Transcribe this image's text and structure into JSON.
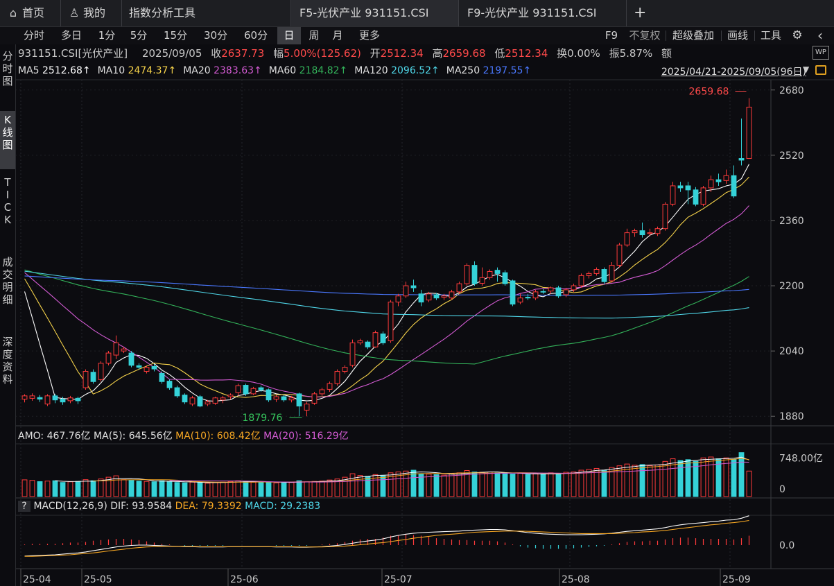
{
  "tabs": [
    {
      "icon": "home-icon",
      "label": "首页"
    },
    {
      "icon": "user-icon",
      "label": "我的"
    },
    {
      "label": "指数分析工具"
    },
    {
      "label": "F5-光伏产业 931151.CSI"
    },
    {
      "label": "F9-光伏产业 931151.CSI"
    },
    {
      "label": "+"
    }
  ],
  "periods": [
    "分时",
    "多日",
    "1分",
    "5分",
    "15分",
    "30分",
    "60分",
    "日",
    "周",
    "月",
    "更多"
  ],
  "active_period": "日",
  "toolbar_right": [
    "F9",
    "不复权",
    "超级叠加",
    "画线",
    "工具"
  ],
  "side_nav": [
    "分时图",
    "K线图",
    "TICK",
    "成交明细",
    "深度资料"
  ],
  "quote": {
    "code": "931151.CSI[光伏产业]",
    "date": "2025/09/05",
    "close_label": "收",
    "close": "2637.73",
    "change_label": "幅",
    "change": "5.00%(125.62)",
    "open_label": "开",
    "open": "2512.34",
    "high_label": "高",
    "high": "2659.68",
    "low_label": "低",
    "low": "2512.34",
    "turnover_label": "换",
    "turnover": "0.00%",
    "amplitude_label": "振",
    "amplitude": "5.87%",
    "amount_label": "额"
  },
  "ma_row": [
    {
      "label": "MA5",
      "value": "2512.68↑",
      "color": "#ffffff"
    },
    {
      "label": "MA10",
      "value": "2474.37↑",
      "color": "#f5d24a"
    },
    {
      "label": "MA20",
      "value": "2383.63↑",
      "color": "#d35bd3"
    },
    {
      "label": "MA60",
      "value": "2184.82↑",
      "color": "#33b35a"
    },
    {
      "label": "MA120",
      "value": "2096.52↑",
      "color": "#4fd6e8"
    },
    {
      "label": "MA250",
      "value": "2197.55↑",
      "color": "#4a78ff"
    }
  ],
  "range_text": "2025/04/21-2025/09/05(96日)",
  "price_axis": [
    "2680",
    "2520",
    "2360",
    "2200",
    "2040",
    "1880"
  ],
  "high_marker": "2659.68",
  "low_marker": "1879.76",
  "amo_header": {
    "amo": "AMO: 467.76亿",
    "ma5": "MA(5): 645.56亿",
    "ma10": "MA(10): 608.42亿",
    "ma20": "MA(20): 516.29亿"
  },
  "vol_axis": [
    "748.00亿",
    "0"
  ],
  "macd_header": {
    "q": "?",
    "name": "MACD(12,26,9)",
    "dif": "DIF: 93.9584",
    "dea": "DEA: 79.3392",
    "macd": "MACD: 29.2383"
  },
  "macd_axis": [
    "0.0"
  ],
  "date_axis": [
    "25-04",
    "25-05",
    "25-06",
    "25-07",
    "25-08",
    "25-09"
  ],
  "colors": {
    "up": "#ff3b3b",
    "down": "#35d2d8",
    "ma5": "#ffffff",
    "ma10": "#f5d24a",
    "ma20": "#d35bd3",
    "ma60": "#33b35a",
    "ma120": "#4fd6e8",
    "ma250": "#4a78ff"
  },
  "chart_data": {
    "type": "candlestick",
    "ylim": [
      1860,
      2700
    ],
    "candles": [
      [
        1922,
        1930,
        1914,
        1934
      ],
      [
        1924,
        1930,
        1918,
        1936
      ],
      [
        1926,
        1922,
        1915,
        1932
      ],
      [
        1910,
        1930,
        1905,
        1934
      ],
      [
        1930,
        1920,
        1912,
        1935
      ],
      [
        1922,
        1915,
        1908,
        1928
      ],
      [
        1918,
        1925,
        1912,
        1930
      ],
      [
        1924,
        1918,
        1910,
        1928
      ],
      [
        1950,
        1990,
        1945,
        1995
      ],
      [
        1988,
        1965,
        1960,
        1995
      ],
      [
        1970,
        2010,
        1965,
        2015
      ],
      [
        2010,
        2035,
        2005,
        2040
      ],
      [
        2030,
        2060,
        2020,
        2078
      ],
      [
        2040,
        2045,
        2035,
        2050
      ],
      [
        2035,
        2005,
        2000,
        2040
      ],
      [
        2004,
        2000,
        1995,
        2010
      ],
      [
        1990,
        2000,
        1985,
        2005
      ],
      [
        2002,
        1996,
        1990,
        2008
      ],
      [
        1985,
        1965,
        1960,
        1990
      ],
      [
        1966,
        1950,
        1945,
        1970
      ],
      [
        1950,
        1930,
        1925,
        1955
      ],
      [
        1932,
        1915,
        1910,
        1936
      ],
      [
        1910,
        1925,
        1905,
        1930
      ],
      [
        1928,
        1905,
        1902,
        1932
      ],
      [
        1910,
        1915,
        1905,
        1920
      ],
      [
        1912,
        1925,
        1908,
        1928
      ],
      [
        1920,
        1925,
        1912,
        1930
      ],
      [
        1928,
        1932,
        1922,
        1936
      ],
      [
        1938,
        1955,
        1930,
        1960
      ],
      [
        1956,
        1935,
        1930,
        1960
      ],
      [
        1935,
        1948,
        1932,
        1952
      ],
      [
        1950,
        1945,
        1940,
        1955
      ],
      [
        1945,
        1920,
        1915,
        1948
      ],
      [
        1922,
        1928,
        1915,
        1932
      ],
      [
        1928,
        1920,
        1915,
        1932
      ],
      [
        1920,
        1925,
        1914,
        1930
      ],
      [
        1935,
        1905,
        1880,
        1938
      ],
      [
        1895,
        1910,
        1880,
        1915
      ],
      [
        1912,
        1935,
        1908,
        1940
      ],
      [
        1935,
        1945,
        1930,
        1950
      ],
      [
        1946,
        1960,
        1940,
        1965
      ],
      [
        1960,
        1990,
        1955,
        1995
      ],
      [
        1990,
        2000,
        1985,
        2005
      ],
      [
        2005,
        2060,
        2000,
        2068
      ],
      [
        2060,
        2065,
        2055,
        2070
      ],
      [
        2062,
        2050,
        2045,
        2066
      ],
      [
        2050,
        2085,
        2048,
        2090
      ],
      [
        2082,
        2060,
        2055,
        2088
      ],
      [
        2065,
        2160,
        2060,
        2165
      ],
      [
        2160,
        2175,
        2150,
        2180
      ],
      [
        2175,
        2200,
        2170,
        2210
      ],
      [
        2200,
        2195,
        2185,
        2215
      ],
      [
        2180,
        2160,
        2150,
        2190
      ],
      [
        2165,
        2180,
        2160,
        2185
      ],
      [
        2178,
        2170,
        2165,
        2182
      ],
      [
        2172,
        2175,
        2165,
        2180
      ],
      [
        2170,
        2185,
        2165,
        2190
      ],
      [
        2185,
        2205,
        2180,
        2210
      ],
      [
        2205,
        2250,
        2200,
        2255
      ],
      [
        2250,
        2205,
        2200,
        2260
      ],
      [
        2206,
        2220,
        2200,
        2245
      ],
      [
        2220,
        2235,
        2215,
        2240
      ],
      [
        2238,
        2230,
        2210,
        2245
      ],
      [
        2232,
        2205,
        2200,
        2238
      ],
      [
        2212,
        2155,
        2150,
        2215
      ],
      [
        2160,
        2170,
        2155,
        2180
      ],
      [
        2172,
        2170,
        2165,
        2180
      ],
      [
        2170,
        2185,
        2165,
        2190
      ],
      [
        2186,
        2185,
        2180,
        2192
      ],
      [
        2187,
        2195,
        2180,
        2198
      ],
      [
        2195,
        2175,
        2170,
        2200
      ],
      [
        2178,
        2190,
        2172,
        2195
      ],
      [
        2190,
        2200,
        2185,
        2205
      ],
      [
        2200,
        2225,
        2195,
        2230
      ],
      [
        2225,
        2230,
        2218,
        2235
      ],
      [
        2230,
        2240,
        2225,
        2245
      ],
      [
        2240,
        2210,
        2205,
        2245
      ],
      [
        2212,
        2250,
        2208,
        2258
      ],
      [
        2250,
        2300,
        2245,
        2305
      ],
      [
        2300,
        2330,
        2295,
        2340
      ],
      [
        2330,
        2335,
        2320,
        2340
      ],
      [
        2335,
        2325,
        2318,
        2355
      ],
      [
        2328,
        2330,
        2322,
        2340
      ],
      [
        2328,
        2340,
        2322,
        2345
      ],
      [
        2340,
        2400,
        2335,
        2405
      ],
      [
        2400,
        2445,
        2395,
        2455
      ],
      [
        2445,
        2440,
        2430,
        2455
      ],
      [
        2445,
        2435,
        2400,
        2455
      ],
      [
        2435,
        2400,
        2395,
        2442
      ],
      [
        2400,
        2440,
        2395,
        2445
      ],
      [
        2440,
        2460,
        2430,
        2470
      ],
      [
        2460,
        2455,
        2445,
        2475
      ],
      [
        2458,
        2470,
        2450,
        2485
      ],
      [
        2470,
        2420,
        2415,
        2495
      ],
      [
        2512,
        2508,
        2495,
        2610
      ],
      [
        2512,
        2638,
        2512,
        2660
      ]
    ],
    "volume": [
      95,
      92,
      85,
      88,
      90,
      80,
      84,
      86,
      96,
      90,
      100,
      110,
      118,
      96,
      92,
      88,
      86,
      84,
      90,
      86,
      80,
      78,
      82,
      80,
      76,
      80,
      82,
      86,
      90,
      85,
      82,
      84,
      80,
      78,
      82,
      80,
      90,
      84,
      86,
      88,
      94,
      100,
      110,
      130,
      120,
      115,
      125,
      118,
      135,
      140,
      145,
      150,
      130,
      128,
      125,
      122,
      130,
      135,
      148,
      140,
      138,
      140,
      135,
      130,
      128,
      132,
      125,
      130,
      128,
      135,
      130,
      138,
      140,
      150,
      155,
      160,
      150,
      165,
      175,
      185,
      178,
      182,
      175,
      180,
      200,
      215,
      205,
      210,
      200,
      220,
      225,
      215,
      220,
      210,
      250,
      145
    ],
    "macd_dif": [
      -35,
      -34,
      -33,
      -32,
      -31,
      -29,
      -27,
      -25,
      -22,
      -18,
      -14,
      -10,
      -6,
      -3,
      -1,
      0,
      0,
      -1,
      -2,
      -3,
      -4,
      -5,
      -5,
      -6,
      -6,
      -6,
      -6,
      -5,
      -5,
      -5,
      -5,
      -5,
      -5,
      -6,
      -6,
      -6,
      -7,
      -7,
      -6,
      -5,
      -3,
      -1,
      2,
      6,
      10,
      13,
      16,
      20,
      26,
      31,
      35,
      38,
      40,
      41,
      42,
      43,
      44,
      45,
      47,
      48,
      49,
      50,
      50,
      49,
      46,
      43,
      40,
      38,
      36,
      35,
      34,
      33,
      33,
      33,
      34,
      35,
      36,
      38,
      41,
      44,
      46,
      48,
      50,
      52,
      56,
      61,
      65,
      68,
      70,
      72,
      75,
      77,
      80,
      81,
      86,
      94
    ],
    "macd_dea": [
      -36,
      -36,
      -35,
      -34,
      -33,
      -32,
      -31,
      -29,
      -27,
      -25,
      -22,
      -19,
      -16,
      -13,
      -10,
      -8,
      -6,
      -5,
      -4,
      -4,
      -4,
      -4,
      -4,
      -5,
      -5,
      -5,
      -5,
      -5,
      -5,
      -5,
      -5,
      -5,
      -5,
      -5,
      -5,
      -5,
      -6,
      -6,
      -6,
      -6,
      -5,
      -4,
      -3,
      -1,
      1,
      3,
      6,
      8,
      11,
      15,
      18,
      22,
      25,
      28,
      31,
      33,
      35,
      37,
      39,
      41,
      42,
      43,
      44,
      45,
      45,
      45,
      44,
      43,
      42,
      41,
      40,
      39,
      38,
      37,
      37,
      37,
      37,
      37,
      38,
      39,
      40,
      42,
      43,
      45,
      47,
      50,
      53,
      56,
      59,
      62,
      65,
      67,
      70,
      72,
      75,
      79
    ]
  }
}
